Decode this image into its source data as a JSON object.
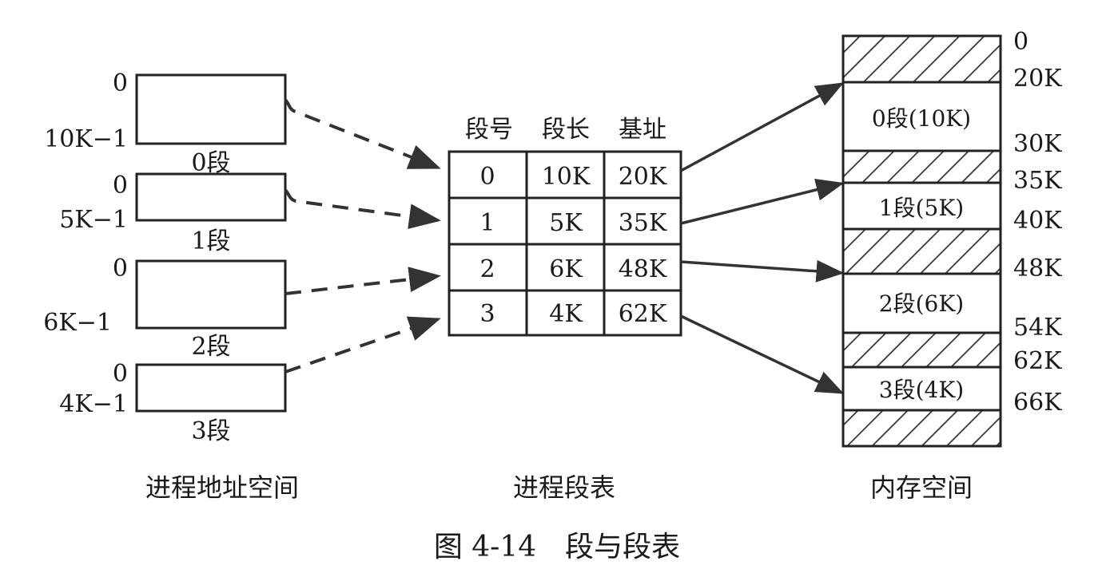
{
  "process_space": {
    "label": "进程地址空间",
    "segments": [
      {
        "start": "0",
        "end": "10K−1",
        "name": "0段"
      },
      {
        "start": "0",
        "end": "5K−1",
        "name": "1段"
      },
      {
        "start": "0",
        "end": "6K−1",
        "name": "2段"
      },
      {
        "start": "0",
        "end": "4K−1",
        "name": "3段"
      }
    ]
  },
  "segment_table": {
    "label": "进程段表",
    "headers": [
      "段号",
      "段长",
      "基址"
    ],
    "rows": [
      [
        "0",
        "10K",
        "20K"
      ],
      [
        "1",
        "5K",
        "35K"
      ],
      [
        "2",
        "6K",
        "48K"
      ],
      [
        "3",
        "4K",
        "62K"
      ]
    ]
  },
  "memory_space": {
    "label": "内存空间",
    "blocks": [
      {
        "kind": "used",
        "from": 0,
        "to": 20
      },
      {
        "kind": "segment",
        "from": 20,
        "to": 30,
        "text": "0段(10K)"
      },
      {
        "kind": "used",
        "from": 30,
        "to": 35
      },
      {
        "kind": "segment",
        "from": 35,
        "to": 40,
        "text": "1段(5K)"
      },
      {
        "kind": "used",
        "from": 40,
        "to": 48
      },
      {
        "kind": "segment",
        "from": 48,
        "to": 54,
        "text": "2段(6K)"
      },
      {
        "kind": "used",
        "from": 54,
        "to": 62
      },
      {
        "kind": "segment",
        "from": 62,
        "to": 66,
        "text": "3段(4K)"
      },
      {
        "kind": "used",
        "from": 66,
        "to": null
      }
    ],
    "addresses": [
      "0",
      "20K",
      "30K",
      "35K",
      "40K",
      "48K",
      "54K",
      "62K",
      "66K"
    ]
  },
  "caption": "图 4-14　段与段表"
}
